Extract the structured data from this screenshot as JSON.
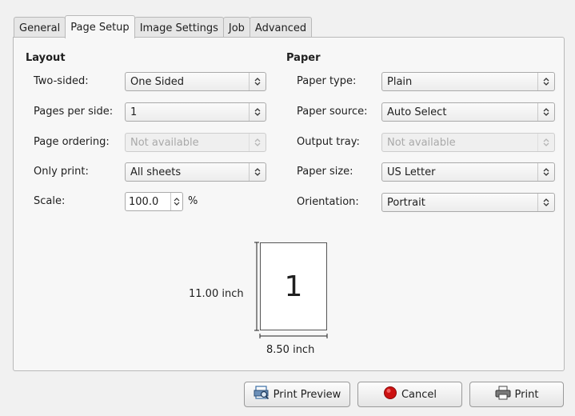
{
  "tabs": [
    "General",
    "Page Setup",
    "Image Settings",
    "Job",
    "Advanced"
  ],
  "active_tab": "Page Setup",
  "layout": {
    "title": "Layout",
    "two_sided": {
      "label": "Two-sided:",
      "value": "One Sided"
    },
    "pages_per_side": {
      "label": "Pages per side:",
      "value": "1"
    },
    "page_ordering": {
      "label": "Page ordering:",
      "value": "Not available"
    },
    "only_print": {
      "label": "Only print:",
      "value": "All sheets"
    },
    "scale": {
      "label": "Scale:",
      "value": "100.0",
      "unit": "%"
    }
  },
  "paper": {
    "title": "Paper",
    "paper_type": {
      "label": "Paper type:",
      "value": "Plain"
    },
    "paper_source": {
      "label": "Paper source:",
      "value": "Auto Select"
    },
    "output_tray": {
      "label": "Output tray:",
      "value": "Not available"
    },
    "paper_size": {
      "label": "Paper size:",
      "value": "US Letter"
    },
    "orientation": {
      "label": "Orientation:",
      "value": "Portrait"
    }
  },
  "preview": {
    "page_number": "1",
    "height_label": "11.00 inch",
    "width_label": "8.50 inch"
  },
  "buttons": {
    "print_preview": "Print Preview",
    "cancel": "Cancel",
    "print": "Print"
  },
  "colors": {
    "cancel_icon": "#cc1111",
    "preview_icon": "#3a6ea5"
  }
}
